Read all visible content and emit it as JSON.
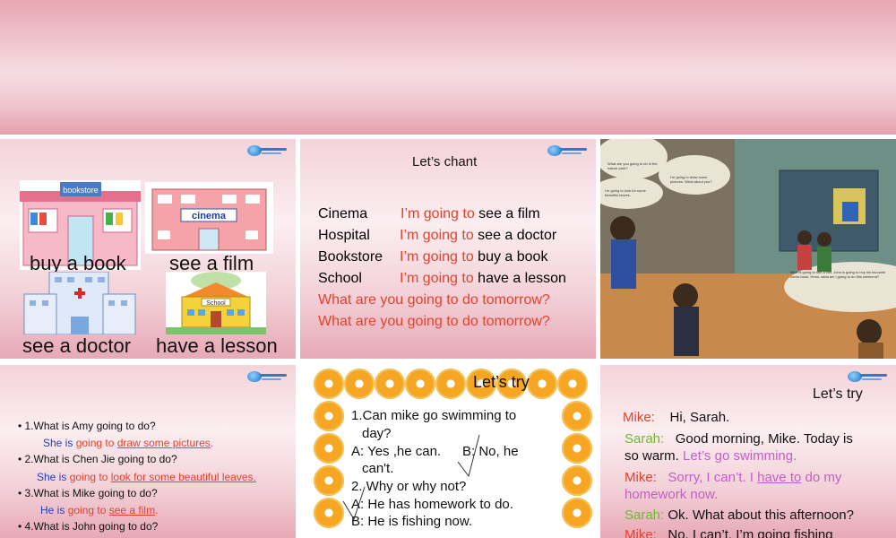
{
  "slide1": {
    "labels": [
      "buy a book",
      "see a film",
      "see a doctor",
      "have a lesson"
    ],
    "signs": [
      "bookstore",
      "cinema",
      "School"
    ]
  },
  "slide2": {
    "title": "Let’s chant",
    "rows": [
      {
        "place": "Cinema",
        "going": "I’m going to",
        "activity": "see a film"
      },
      {
        "place": "Hospital",
        "going": "I’m going to",
        "activity": "see a doctor"
      },
      {
        "place": "Bookstore",
        "going": "I’m going to",
        "activity": "buy a book"
      },
      {
        "place": "School",
        "going": "I’m going to",
        "activity": "have a lesson"
      }
    ],
    "question": "What are you going to do tomorrow?"
  },
  "slide3": {
    "bubbles": [
      "What are you going to do in the nature park?",
      "I’m going to draw some pictures. What about you?",
      "I’m going to look for some beautiful leaves.",
      "Mike is going to see a film. John is going to buy his favourite comic book. Hmm, what am I going to do this weekend?"
    ]
  },
  "slide4": {
    "items": [
      {
        "q": "1.What is Amy going to do?",
        "she": "She is",
        "going": "going to",
        "ans": "draw some pictures",
        "end": "."
      },
      {
        "q": "2.What is Chen Jie going to do?",
        "she": "She is",
        "going": "going to",
        "ans": "look for some beautiful leaves.",
        "end": ""
      },
      {
        "q": "3.What is Mike going to do?",
        "she": "He is",
        "going": "going to",
        "ans": "see a film",
        "end": "."
      },
      {
        "q": "4.What is John going to do?"
      }
    ]
  },
  "slide5": {
    "title": "Let’s try",
    "lines": [
      "1.Can mike go swimming to",
      "day?",
      "A: Yes ,he can.",
      "B: No, he",
      "can't.",
      "2. Why or why not?",
      "A: He has homework to do.",
      "B: He is fishing now."
    ]
  },
  "slide6": {
    "title": "Let’s try",
    "d1_name": "Mike:",
    "d1_text": "Hi, Sarah.",
    "d2_name": "Sarah:",
    "d2_text": "Good morning, Mike. Today is",
    "d2_text2": "so warm.",
    "d2_green": "Let’s go swimming.",
    "d3_name": "Mike:",
    "d3_text": "Sorry, I can’t. I",
    "d3_ul": "have to",
    "d3_text2": "do my",
    "d3_line2": "homework now",
    "d3_end": ".",
    "d4_name": "Sarah:",
    "d4_text": "Ok. What about this afternoon?",
    "d5_name": "Mike:",
    "d5_text": "No, I can’t. I’m going fishing"
  },
  "colors": {
    "red": "#e8412a",
    "blue": "#1f3fbf",
    "green": "#6dbb2c",
    "pink": "#c25fc6"
  }
}
